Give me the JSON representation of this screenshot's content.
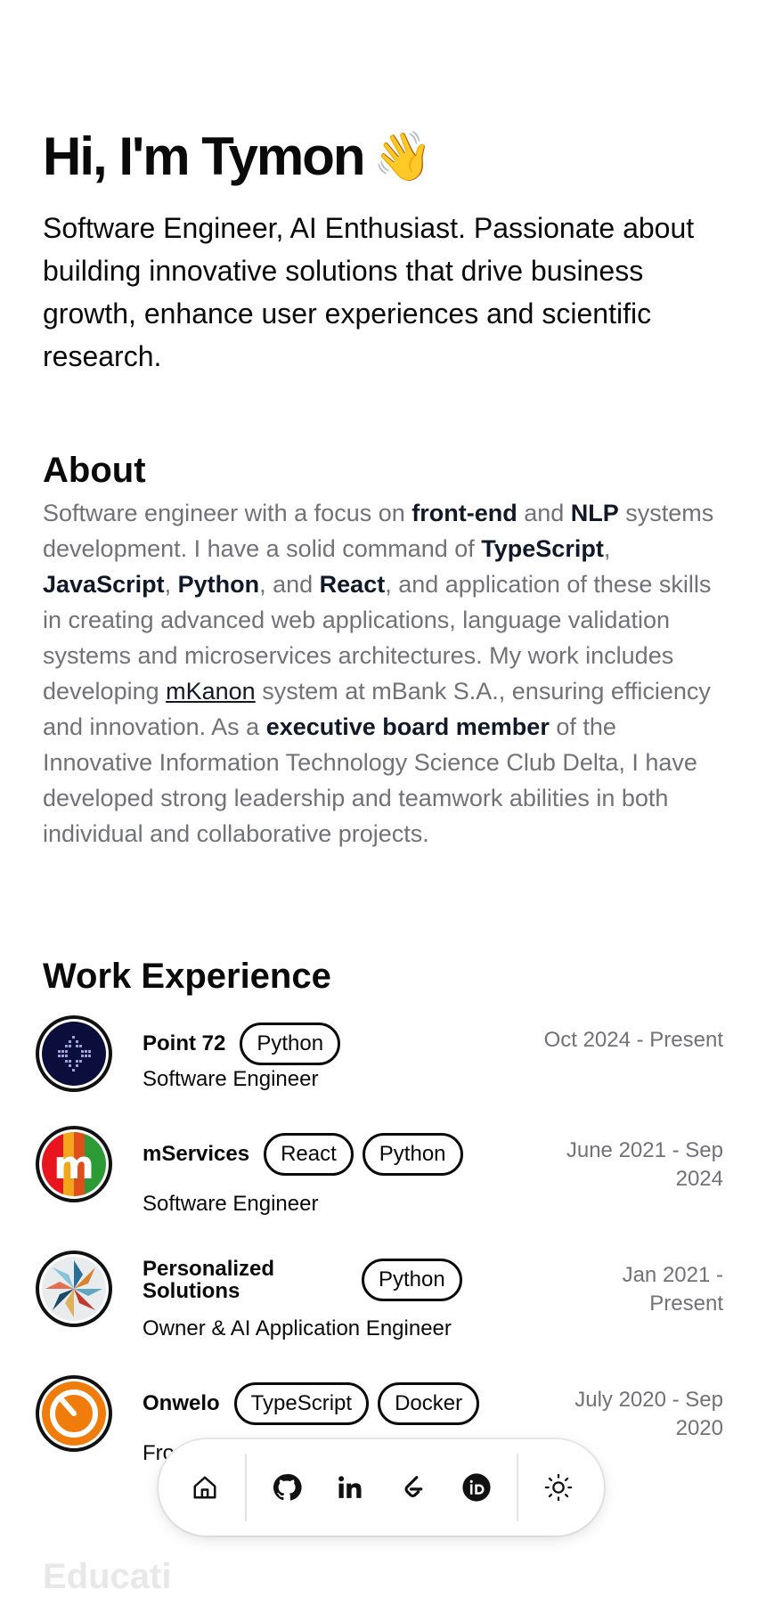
{
  "hero": {
    "title": "Hi, I'm Tymon",
    "wave": "👋",
    "subtitle": "Software Engineer, AI Enthusiast. Passionate about building innovative solutions that drive business growth, enhance user experiences and scientific research."
  },
  "about": {
    "title": "About",
    "t1": "Software engineer with a focus on ",
    "b1": "front-end",
    "t2": " and ",
    "b2": "NLP",
    "t3": " systems development. I have a solid command of ",
    "b3": "TypeScript",
    "t4": ", ",
    "b4": "JavaScript",
    "t5": ", ",
    "b5": "Python",
    "t6": ", and ",
    "b6": "React",
    "t7": ", and application of these skills in creating advanced web applications, language validation systems and microservices architectures. My work includes developing ",
    "link": "mKanon",
    "t8": " system at mBank S.A., ensuring efficiency and innovation. As a ",
    "b7": "executive board member",
    "t9": " of the Innovative Information Technology Science Club Delta, I have developed strong leadership and teamwork abilities in both individual and collaborative projects."
  },
  "work": {
    "title": "Work Experience",
    "jobs": [
      {
        "company": "Point 72",
        "badges": [
          "Python"
        ],
        "role": "Software Engineer",
        "dates": "Oct 2024 - Present"
      },
      {
        "company": "mServices",
        "badges": [
          "React",
          "Python"
        ],
        "role": "Software Engineer",
        "dates": "June 2021 - Sep 2024"
      },
      {
        "company": "Personalized Solutions",
        "badges": [
          "Python"
        ],
        "role": "Owner & AI Application Engineer",
        "dates": "Jan 2021 - Present"
      },
      {
        "company": "Onwelo",
        "badges": [
          "TypeScript",
          "Docker"
        ],
        "role": "Fro",
        "dates": "July 2020 - Sep 2020"
      }
    ]
  },
  "dock": {
    "items": [
      "home-icon",
      "github-icon",
      "linkedin-icon",
      "leetcode-icon",
      "orcid-icon",
      "sun-icon"
    ]
  },
  "education_peek": "Educati"
}
